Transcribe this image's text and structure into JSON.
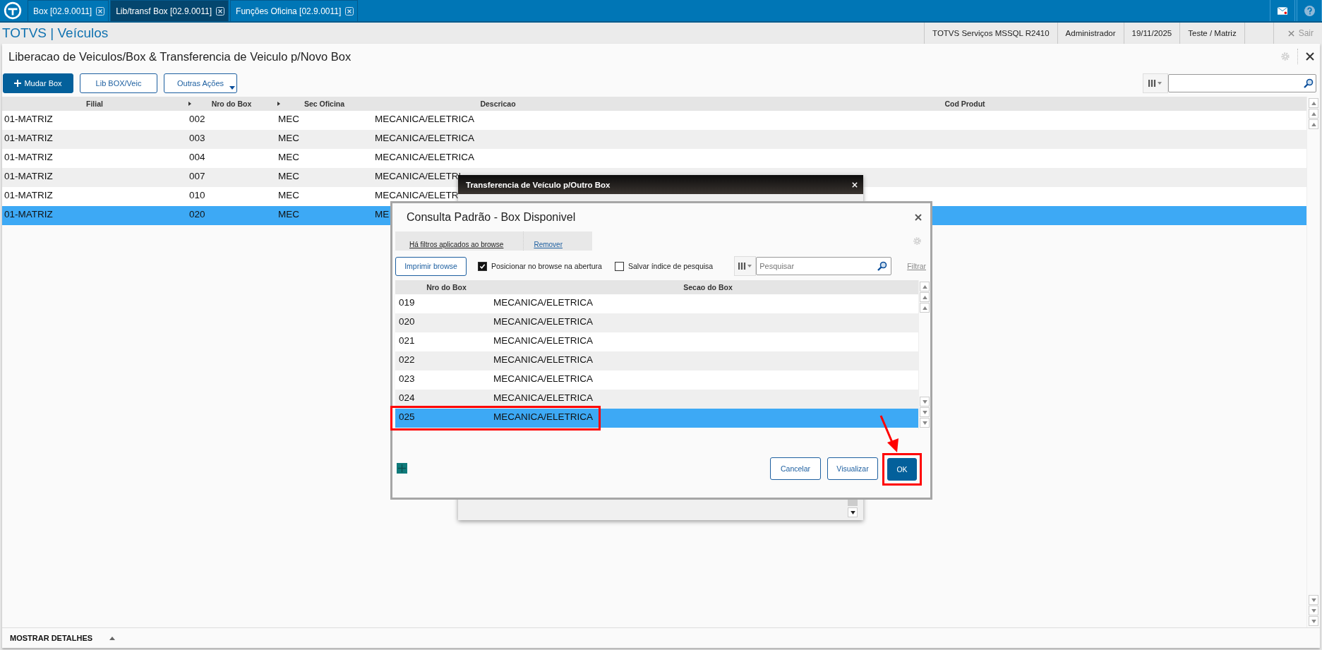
{
  "tabs": [
    {
      "label": "Box [02.9.0011]",
      "selected": false
    },
    {
      "label": "Lib/transf Box [02.9.0011]",
      "selected": true
    },
    {
      "label": "Funções Oficina [02.9.0011]",
      "selected": false
    }
  ],
  "app_title": "TOTVS | Veículos",
  "status": [
    "TOTVS Serviços MSSQL R2410",
    "Administrador",
    "19/11/2025",
    "Teste / Matriz"
  ],
  "exit_label": "Sair",
  "page_title": "Liberacao de Veiculos/Box & Transferencia de Veiculo p/Novo Box",
  "actions": [
    {
      "label": "Mudar Box",
      "kind": "primary"
    },
    {
      "label": "Lib BOX/Veic",
      "kind": "outline"
    },
    {
      "label": "Outras Ações",
      "kind": "menu"
    }
  ],
  "table": {
    "columns": [
      "Filial",
      "Nro do Box",
      "Sec Oficina",
      "Descricao",
      "Cod Produt"
    ],
    "rows": [
      {
        "cells": [
          "01-MATRIZ",
          "002",
          "MEC",
          "MECANICA/ELETRICA"
        ],
        "selected": false
      },
      {
        "cells": [
          "01-MATRIZ",
          "003",
          "MEC",
          "MECANICA/ELETRICA"
        ],
        "selected": false
      },
      {
        "cells": [
          "01-MATRIZ",
          "004",
          "MEC",
          "MECANICA/ELETRICA"
        ],
        "selected": false
      },
      {
        "cells": [
          "01-MATRIZ",
          "007",
          "MEC",
          "MECANICA/ELETRI"
        ],
        "selected": false
      },
      {
        "cells": [
          "01-MATRIZ",
          "010",
          "MEC",
          "MECANICA/ELETR"
        ],
        "selected": false
      },
      {
        "cells": [
          "01-MATRIZ",
          "020",
          "MEC",
          "ME"
        ],
        "selected": true
      }
    ]
  },
  "details_label": "MOSTRAR DETALHES",
  "back_dialog": {
    "title": "Transferencia de Veículo p/Outro Box"
  },
  "dialog": {
    "title": "Consulta Padrão - Box Disponivel",
    "filter_notice": "Há filtros aplicados ao browse",
    "remove_link": "Remover",
    "print_button": "Imprimir browse",
    "options": [
      {
        "label": "Posicionar no browse na abertura",
        "checked": true
      },
      {
        "label": "Salvar índice de pesquisa",
        "checked": false
      }
    ],
    "search": {
      "placeholder": "Pesquisar"
    },
    "filter_link": "Filtrar",
    "columns": [
      "Nro do Box",
      "Secao do Box"
    ],
    "rows": [
      {
        "number": "019",
        "section": "MECANICA/ELETRICA",
        "selected": false,
        "highlighted": false
      },
      {
        "number": "020",
        "section": "MECANICA/ELETRICA",
        "selected": false,
        "highlighted": false
      },
      {
        "number": "021",
        "section": "MECANICA/ELETRICA",
        "selected": false,
        "highlighted": false
      },
      {
        "number": "022",
        "section": "MECANICA/ELETRICA",
        "selected": false,
        "highlighted": false
      },
      {
        "number": "023",
        "section": "MECANICA/ELETRICA",
        "selected": false,
        "highlighted": false
      },
      {
        "number": "024",
        "section": "MECANICA/ELETRICA",
        "selected": false,
        "highlighted": false
      },
      {
        "number": "025",
        "section": "MECANICA/ELETRICA",
        "selected": true,
        "highlighted": true
      }
    ],
    "buttons": [
      {
        "label": "Cancelar",
        "kind": "outline",
        "highlighted": false
      },
      {
        "label": "Visualizar",
        "kind": "outline",
        "highlighted": false
      },
      {
        "label": "OK",
        "kind": "primary",
        "highlighted": true
      }
    ]
  }
}
